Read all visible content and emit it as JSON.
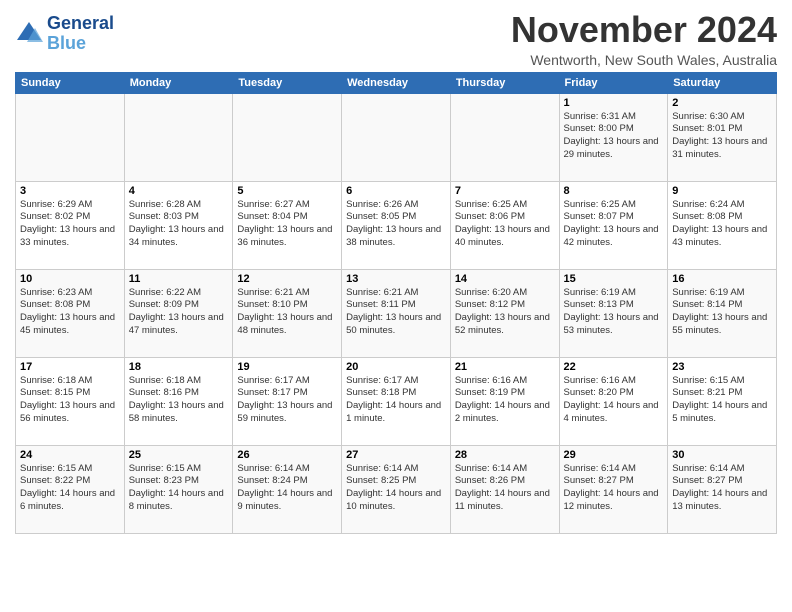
{
  "header": {
    "logo_line1": "General",
    "logo_line2": "Blue",
    "title": "November 2024",
    "subtitle": "Wentworth, New South Wales, Australia"
  },
  "days_of_week": [
    "Sunday",
    "Monday",
    "Tuesday",
    "Wednesday",
    "Thursday",
    "Friday",
    "Saturday"
  ],
  "weeks": [
    [
      {
        "day": "",
        "info": ""
      },
      {
        "day": "",
        "info": ""
      },
      {
        "day": "",
        "info": ""
      },
      {
        "day": "",
        "info": ""
      },
      {
        "day": "",
        "info": ""
      },
      {
        "day": "1",
        "info": "Sunrise: 6:31 AM\nSunset: 8:00 PM\nDaylight: 13 hours\nand 29 minutes."
      },
      {
        "day": "2",
        "info": "Sunrise: 6:30 AM\nSunset: 8:01 PM\nDaylight: 13 hours\nand 31 minutes."
      }
    ],
    [
      {
        "day": "3",
        "info": "Sunrise: 6:29 AM\nSunset: 8:02 PM\nDaylight: 13 hours\nand 33 minutes."
      },
      {
        "day": "4",
        "info": "Sunrise: 6:28 AM\nSunset: 8:03 PM\nDaylight: 13 hours\nand 34 minutes."
      },
      {
        "day": "5",
        "info": "Sunrise: 6:27 AM\nSunset: 8:04 PM\nDaylight: 13 hours\nand 36 minutes."
      },
      {
        "day": "6",
        "info": "Sunrise: 6:26 AM\nSunset: 8:05 PM\nDaylight: 13 hours\nand 38 minutes."
      },
      {
        "day": "7",
        "info": "Sunrise: 6:25 AM\nSunset: 8:06 PM\nDaylight: 13 hours\nand 40 minutes."
      },
      {
        "day": "8",
        "info": "Sunrise: 6:25 AM\nSunset: 8:07 PM\nDaylight: 13 hours\nand 42 minutes."
      },
      {
        "day": "9",
        "info": "Sunrise: 6:24 AM\nSunset: 8:08 PM\nDaylight: 13 hours\nand 43 minutes."
      }
    ],
    [
      {
        "day": "10",
        "info": "Sunrise: 6:23 AM\nSunset: 8:08 PM\nDaylight: 13 hours\nand 45 minutes."
      },
      {
        "day": "11",
        "info": "Sunrise: 6:22 AM\nSunset: 8:09 PM\nDaylight: 13 hours\nand 47 minutes."
      },
      {
        "day": "12",
        "info": "Sunrise: 6:21 AM\nSunset: 8:10 PM\nDaylight: 13 hours\nand 48 minutes."
      },
      {
        "day": "13",
        "info": "Sunrise: 6:21 AM\nSunset: 8:11 PM\nDaylight: 13 hours\nand 50 minutes."
      },
      {
        "day": "14",
        "info": "Sunrise: 6:20 AM\nSunset: 8:12 PM\nDaylight: 13 hours\nand 52 minutes."
      },
      {
        "day": "15",
        "info": "Sunrise: 6:19 AM\nSunset: 8:13 PM\nDaylight: 13 hours\nand 53 minutes."
      },
      {
        "day": "16",
        "info": "Sunrise: 6:19 AM\nSunset: 8:14 PM\nDaylight: 13 hours\nand 55 minutes."
      }
    ],
    [
      {
        "day": "17",
        "info": "Sunrise: 6:18 AM\nSunset: 8:15 PM\nDaylight: 13 hours\nand 56 minutes."
      },
      {
        "day": "18",
        "info": "Sunrise: 6:18 AM\nSunset: 8:16 PM\nDaylight: 13 hours\nand 58 minutes."
      },
      {
        "day": "19",
        "info": "Sunrise: 6:17 AM\nSunset: 8:17 PM\nDaylight: 13 hours\nand 59 minutes."
      },
      {
        "day": "20",
        "info": "Sunrise: 6:17 AM\nSunset: 8:18 PM\nDaylight: 14 hours\nand 1 minute."
      },
      {
        "day": "21",
        "info": "Sunrise: 6:16 AM\nSunset: 8:19 PM\nDaylight: 14 hours\nand 2 minutes."
      },
      {
        "day": "22",
        "info": "Sunrise: 6:16 AM\nSunset: 8:20 PM\nDaylight: 14 hours\nand 4 minutes."
      },
      {
        "day": "23",
        "info": "Sunrise: 6:15 AM\nSunset: 8:21 PM\nDaylight: 14 hours\nand 5 minutes."
      }
    ],
    [
      {
        "day": "24",
        "info": "Sunrise: 6:15 AM\nSunset: 8:22 PM\nDaylight: 14 hours\nand 6 minutes."
      },
      {
        "day": "25",
        "info": "Sunrise: 6:15 AM\nSunset: 8:23 PM\nDaylight: 14 hours\nand 8 minutes."
      },
      {
        "day": "26",
        "info": "Sunrise: 6:14 AM\nSunset: 8:24 PM\nDaylight: 14 hours\nand 9 minutes."
      },
      {
        "day": "27",
        "info": "Sunrise: 6:14 AM\nSunset: 8:25 PM\nDaylight: 14 hours\nand 10 minutes."
      },
      {
        "day": "28",
        "info": "Sunrise: 6:14 AM\nSunset: 8:26 PM\nDaylight: 14 hours\nand 11 minutes."
      },
      {
        "day": "29",
        "info": "Sunrise: 6:14 AM\nSunset: 8:27 PM\nDaylight: 14 hours\nand 12 minutes."
      },
      {
        "day": "30",
        "info": "Sunrise: 6:14 AM\nSunset: 8:27 PM\nDaylight: 14 hours\nand 13 minutes."
      }
    ]
  ]
}
